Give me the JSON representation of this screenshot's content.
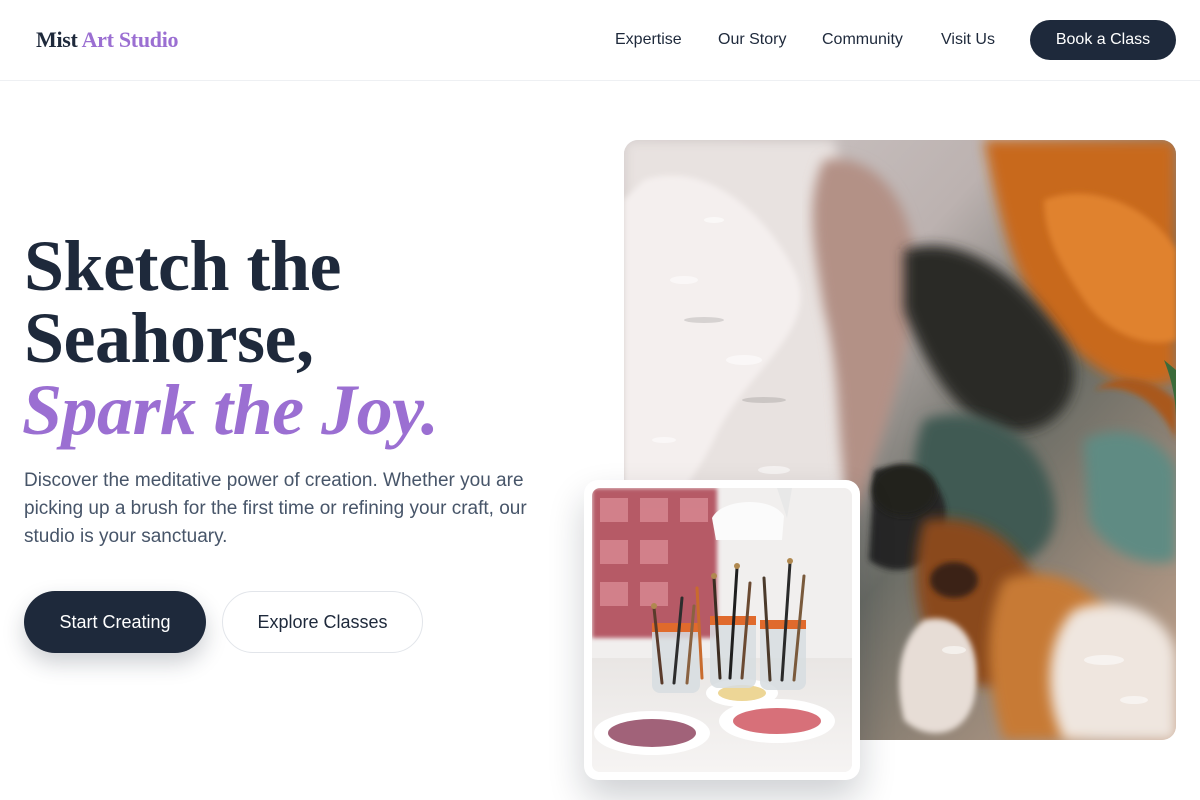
{
  "header": {
    "logo_part1": "Mist",
    "logo_part2": "Art Studio",
    "nav": [
      "Expertise",
      "Our Story",
      "Community",
      "Visit Us"
    ],
    "cta": "Book a Class"
  },
  "hero": {
    "headline_line1": "Sketch the",
    "headline_line2": "Seahorse,",
    "headline_accent": "Spark the Joy.",
    "description": "Discover the meditative power of creation. Whether you are picking up a brush for the first time or refining your craft, our studio is your sanctuary.",
    "primary_button": "Start Creating",
    "secondary_button": "Explore Classes"
  },
  "images": {
    "main": "abstract-textured-paint-photo",
    "inset": "paintbrush-jars-photo"
  },
  "colors": {
    "navy": "#1e293b",
    "accent_purple": "#9b6fd2",
    "muted_text": "#475569"
  }
}
